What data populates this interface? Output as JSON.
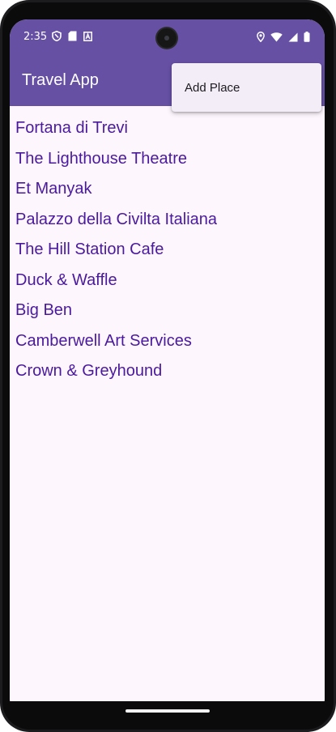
{
  "status_bar": {
    "time": "2:35",
    "left_icons": [
      "shield-icon",
      "sd-card-icon",
      "font-a-icon"
    ],
    "right_icons": [
      "location-icon",
      "wifi-icon",
      "signal-icon",
      "battery-icon"
    ]
  },
  "app_bar": {
    "title": "Travel App",
    "background": "#6650a4"
  },
  "overflow_menu": {
    "items": [
      {
        "label": "Add Place"
      }
    ]
  },
  "places": [
    {
      "name": "Fortana di Trevi"
    },
    {
      "name": "The Lighthouse Theatre"
    },
    {
      "name": "Et Manyak"
    },
    {
      "name": "Palazzo della Civilta Italiana"
    },
    {
      "name": "The Hill Station Cafe"
    },
    {
      "name": "Duck & Waffle"
    },
    {
      "name": "Big Ben"
    },
    {
      "name": "Camberwell Art Services"
    },
    {
      "name": "Crown & Greyhound"
    }
  ],
  "colors": {
    "primary": "#6650a4",
    "list_text": "#4a1a9e",
    "surface": "#fdf6fd",
    "menu_surface": "#f3edf7"
  }
}
